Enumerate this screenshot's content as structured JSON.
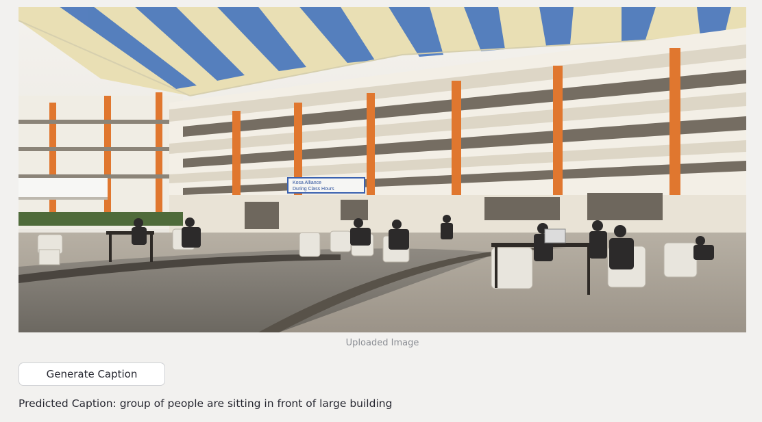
{
  "image": {
    "description_icon": "photo-image-icon",
    "banner_text": [
      "Kosa Alliance",
      "During Class Hours"
    ],
    "caption": "Uploaded Image"
  },
  "actions": {
    "generate_label": "Generate Caption"
  },
  "result": {
    "prefix": "Predicted Caption:",
    "caption": "group of people are sitting in front of large building"
  },
  "colors": {
    "background": "#f2f1ef",
    "text": "#262730",
    "muted": "#8a8d93"
  }
}
